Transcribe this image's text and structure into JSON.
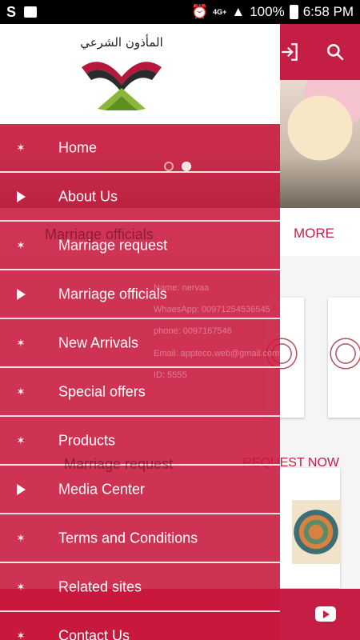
{
  "status_bar": {
    "network": "4G+",
    "battery": "100%",
    "time": "6:58 PM"
  },
  "header": {
    "logo_text": "المأذون الشرعي",
    "icons": [
      "login-icon",
      "search-icon"
    ]
  },
  "drawer": {
    "items": [
      {
        "label": "Home",
        "icon": "star-icon"
      },
      {
        "label": "About Us",
        "icon": "triangle-icon"
      },
      {
        "label": "Marriage request",
        "icon": "star-icon"
      },
      {
        "label": "Marriage officials",
        "icon": "triangle-icon"
      },
      {
        "label": "New Arrivals",
        "icon": "star-icon"
      },
      {
        "label": "Special offers",
        "icon": "star-icon"
      },
      {
        "label": "Products",
        "icon": "star-icon"
      },
      {
        "label": "Media Center",
        "icon": "triangle-icon"
      },
      {
        "label": "Terms and Conditions",
        "icon": "star-icon"
      },
      {
        "label": "Related sites",
        "icon": "star-icon"
      },
      {
        "label": "Contact Us",
        "icon": "star-icon"
      }
    ]
  },
  "background": {
    "more_label": "MORE",
    "section_officials": "Marriage officials",
    "section_request": "Marriage request",
    "request_now": "REQUEST NOW",
    "card": {
      "name": "Name: nervaa",
      "whatsapp": "WhaesApp: 00971254536545",
      "phone": "phone: 0097167546",
      "email": "Email: appteco.web@gmail.com",
      "id": "ID: 5555"
    }
  },
  "colors": {
    "brand": "#c41e45",
    "drawer": "#c8183e"
  }
}
